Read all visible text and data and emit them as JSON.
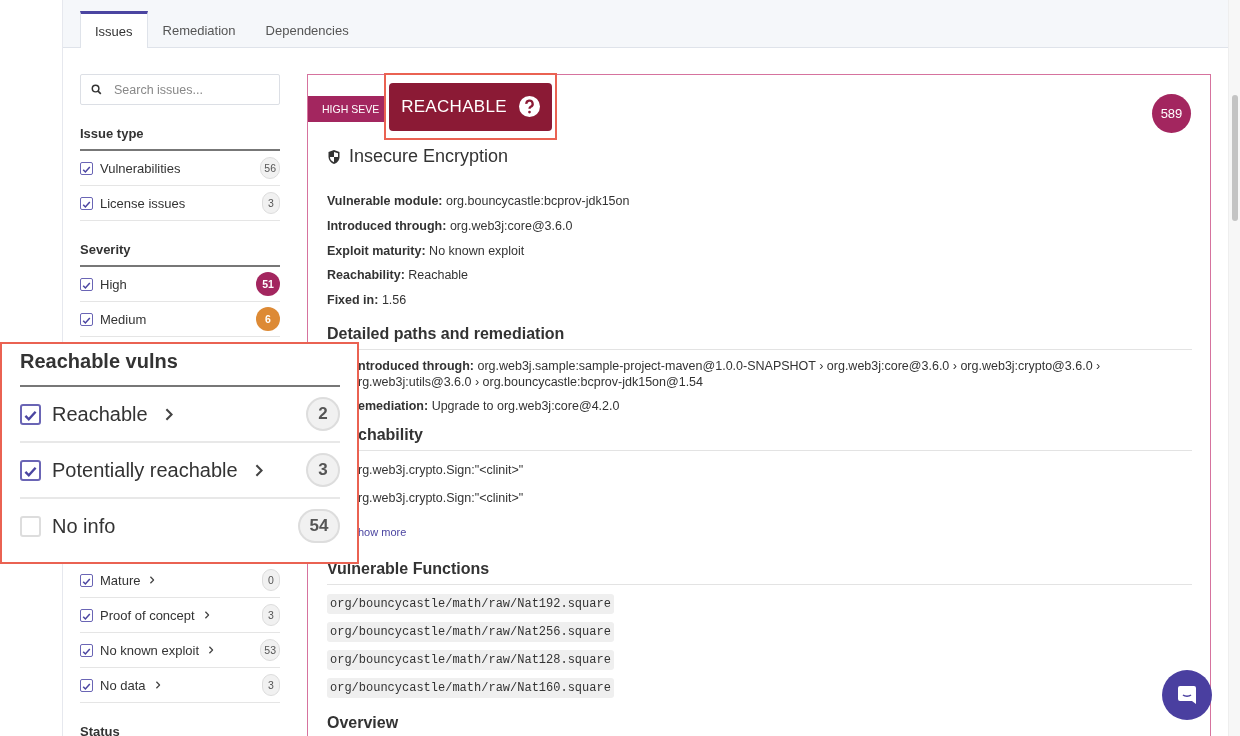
{
  "tabs": [
    {
      "label": "Issues",
      "selected": true
    },
    {
      "label": "Remediation",
      "selected": false
    },
    {
      "label": "Dependencies",
      "selected": false
    }
  ],
  "search": {
    "placeholder": "Search issues..."
  },
  "filters": [
    {
      "title": "Issue type",
      "items": [
        {
          "label": "Vulnerabilities",
          "checked": true,
          "count": "56",
          "kind": "plain"
        },
        {
          "label": "License issues",
          "checked": true,
          "count": "3",
          "kind": "plain"
        }
      ]
    },
    {
      "title": "Severity",
      "items": [
        {
          "label": "High",
          "checked": true,
          "count": "51",
          "kind": "plain",
          "color": "#a3265f"
        },
        {
          "label": "Medium",
          "checked": true,
          "count": "6",
          "kind": "plain",
          "color": "#dd8a35"
        }
      ]
    },
    {
      "items": [
        {
          "label": "Mature",
          "checked": true,
          "count": "0",
          "kind": "drill"
        },
        {
          "label": "Proof of concept",
          "checked": true,
          "count": "3",
          "kind": "drill"
        },
        {
          "label": "No known exploit",
          "checked": true,
          "count": "53",
          "kind": "drill"
        },
        {
          "label": "No data",
          "checked": true,
          "count": "3",
          "kind": "drill"
        }
      ]
    },
    {
      "title": "Status"
    }
  ],
  "issue": {
    "severity": "HIGH SEVE",
    "count": "589",
    "title": "Insecure Encryption",
    "facts": [
      "**Vulnerable module:** org.bouncycastle:bcprov-jdk15on",
      "**Introduced through:** org.web3j:core@3.6.0",
      "**Exploit maturity:** No known exploit",
      "**Reachability:** Reachable",
      "**Fixed in:** 1.56"
    ],
    "sections": [
      {
        "heading": "Detailed paths and remediation",
        "kind": "facts",
        "lines": [
          "**ntroduced through:** org.web3j.sample:sample-project-maven@1.0.0-SNAPSHOT › org.web3j:core@3.6.0 › org.web3j:crypto@3.6.0 › rg.web3j:utils@3.6.0 › org.bouncycastle:bcprov-jdk15on@1.54",
          "**emediation:** Upgrade to org.web3j:core@4.2.0"
        ]
      },
      {
        "heading": "chability",
        "kind": "list",
        "lines": [
          "rg.web3j.crypto.Sign:\"<clinit>\"",
          "rg.web3j.crypto.Sign:\"<clinit>\""
        ],
        "link": "how more"
      },
      {
        "heading": "Vulnerable Functions",
        "kind": "code",
        "lines": [
          "org/bouncycastle/math/raw/Nat192.square",
          "org/bouncycastle/math/raw/Nat256.square",
          "org/bouncycastle/math/raw/Nat128.square",
          "org/bouncycastle/math/raw/Nat160.square"
        ]
      },
      {
        "heading": "Overview",
        "kind": "text"
      }
    ]
  },
  "reachable_badge": {
    "label": "REACHABLE"
  },
  "reachable_popup": {
    "title": "Reachable vulns",
    "items": [
      {
        "label": "Reachable",
        "checked": true,
        "count": "2",
        "kind": "drill"
      },
      {
        "label": "Potentially reachable",
        "checked": true,
        "count": "3",
        "kind": "drill"
      },
      {
        "label": "No info",
        "checked": false,
        "count": "54",
        "kind": "plain"
      }
    ]
  }
}
